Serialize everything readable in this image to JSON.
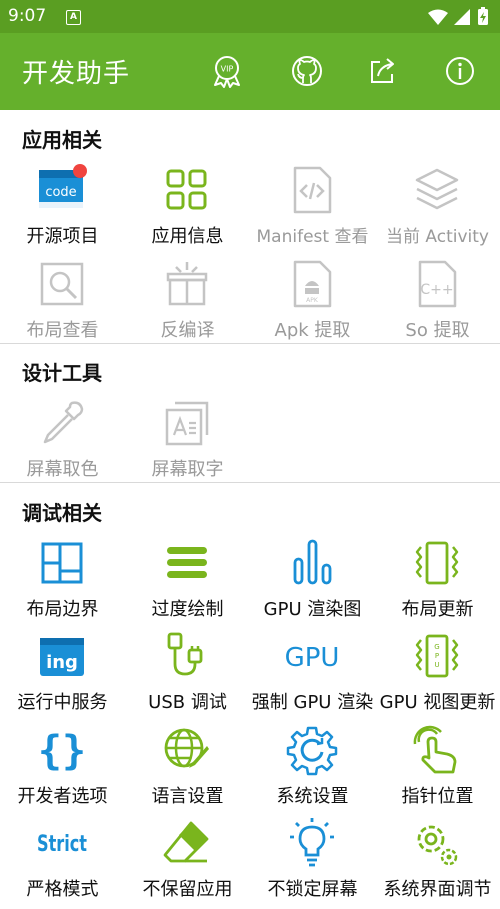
{
  "status_bar": {
    "time": "9:07",
    "notification_icon": "A"
  },
  "app_bar": {
    "title": "开发助手",
    "actions": [
      "vip-icon",
      "github-icon",
      "share-icon",
      "info-icon"
    ]
  },
  "sections": [
    {
      "title": "应用相关"
    },
    {
      "title": "设计工具"
    },
    {
      "title": "调试相关"
    }
  ],
  "items": {
    "open_source": "开源项目",
    "app_info": "应用信息",
    "manifest": "Manifest 查看",
    "current_activity": "当前 Activity",
    "layout_view": "布局查看",
    "decompile": "反编译",
    "apk_extract": "Apk 提取",
    "so_extract": "So 提取",
    "screen_color": "屏幕取色",
    "screen_text": "屏幕取字",
    "layout_bounds": "布局边界",
    "overdraw": "过度绘制",
    "gpu_render": "GPU 渲染图",
    "layout_update": "布局更新",
    "running_services": "运行中服务",
    "usb_debug": "USB 调试",
    "force_gpu": "强制 GPU 渲染",
    "gpu_view_update": "GPU 视图更新",
    "developer_options": "开发者选项",
    "language": "语言设置",
    "system_settings": "系统设置",
    "pointer": "指针位置",
    "strict_mode": "严格模式",
    "no_keep_activities": "不保留应用",
    "stay_awake": "不锁定屏幕",
    "system_ui_tuner": "系统界面调节"
  },
  "icon_text": {
    "code": "code",
    "ing": "ing",
    "gpu": "GPU",
    "strict": "Strict",
    "vip": "VIP",
    "cpp": "C++",
    "apk": "APK"
  },
  "colors": {
    "status": "#5a9e22",
    "app_bar": "#65b02c",
    "accent_blue": "#1a8fd6",
    "accent_green": "#7ab51d",
    "disabled": "#c4c4c4",
    "badge": "#f0443f"
  }
}
